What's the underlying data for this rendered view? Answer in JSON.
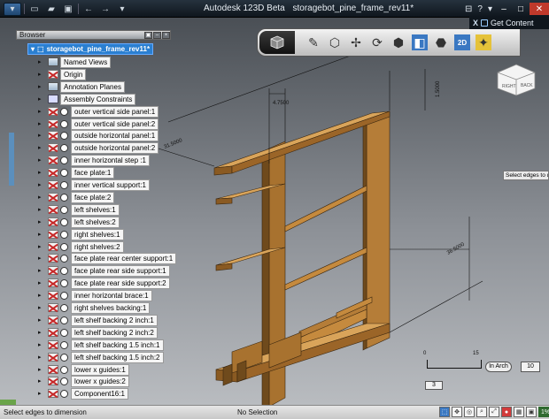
{
  "titlebar": {
    "app_name": "Autodesk 123D Beta",
    "doc_name": "storagebot_pine_frame_rev11*",
    "help": "?",
    "minimize": "–",
    "maximize": "□",
    "close": "✕"
  },
  "get_content": {
    "close_label": "X",
    "label": "Get Content"
  },
  "browser": {
    "title": "Browser",
    "root": "storagebot_pine_frame_rev11*",
    "items": [
      {
        "label": "Named Views",
        "type": "folder",
        "eye": false
      },
      {
        "label": "Origin",
        "type": "comp",
        "eye": false
      },
      {
        "label": "Annotation Planes",
        "type": "folder",
        "eye": false
      },
      {
        "label": "Assembly Constraints",
        "type": "link",
        "eye": false
      },
      {
        "label": "outer vertical side panel:1",
        "type": "comp",
        "eye": true
      },
      {
        "label": "outer vertical side panel:2",
        "type": "comp",
        "eye": true
      },
      {
        "label": "outside horizontal panel:1",
        "type": "comp",
        "eye": true
      },
      {
        "label": "outside horizontal panel:2",
        "type": "comp",
        "eye": true
      },
      {
        "label": "inner horizontal step :1",
        "type": "comp",
        "eye": true
      },
      {
        "label": "face plate:1",
        "type": "comp",
        "eye": true
      },
      {
        "label": "inner vertical support:1",
        "type": "comp",
        "eye": true
      },
      {
        "label": "face plate:2",
        "type": "comp",
        "eye": true
      },
      {
        "label": "left shelves:1",
        "type": "comp",
        "eye": true
      },
      {
        "label": "left shelves:2",
        "type": "comp",
        "eye": true
      },
      {
        "label": "right shelves:1",
        "type": "comp",
        "eye": true
      },
      {
        "label": "right shelves:2",
        "type": "comp",
        "eye": true
      },
      {
        "label": "face plate rear center support:1",
        "type": "comp",
        "eye": true
      },
      {
        "label": "face plate rear side support:1",
        "type": "comp",
        "eye": true
      },
      {
        "label": "face plate rear side support:2",
        "type": "comp",
        "eye": true
      },
      {
        "label": "inner horizontal brace:1",
        "type": "comp",
        "eye": true
      },
      {
        "label": "right shelves backing:1",
        "type": "comp",
        "eye": true
      },
      {
        "label": "left shelf backing 2 inch:1",
        "type": "comp",
        "eye": true
      },
      {
        "label": "left shelf backing 2 inch:2",
        "type": "comp",
        "eye": true
      },
      {
        "label": "left shelf backing 1.5 inch:1",
        "type": "comp",
        "eye": true
      },
      {
        "label": "left shelf backing 1.5 inch:2",
        "type": "comp",
        "eye": true
      },
      {
        "label": "lower x guides:1",
        "type": "comp",
        "eye": true
      },
      {
        "label": "lower x guides:2",
        "type": "comp",
        "eye": true
      },
      {
        "label": "Component16:1",
        "type": "comp",
        "eye": true
      }
    ]
  },
  "toolbar": {
    "tools": [
      "pencil-tool",
      "box-tool",
      "move-tool",
      "rotate-tool",
      "look-at-tool",
      "view-tool",
      "orbit-tool",
      "2d-tool",
      "render-tool"
    ],
    "label_2d": "2D"
  },
  "viewcube": {
    "front": "RIGHT",
    "side": "BACK"
  },
  "dimensions": {
    "top_depth": "4.7500",
    "top_height": "1.5000",
    "width": "31.5000",
    "height": "36.5000"
  },
  "scale": {
    "min": "0",
    "max": "15",
    "value": "3"
  },
  "units": {
    "label": "In Arch",
    "zoom": "10"
  },
  "tooltip": "Select edges to d",
  "statusbar": {
    "left": "Select edges to dimension",
    "center": "No Selection",
    "zoom_pct": "1%"
  },
  "colors": {
    "accent": "#2a7fd1",
    "wood_face": "#c58a3e",
    "wood_side": "#8a5a22",
    "wood_top": "#d9a45a"
  }
}
